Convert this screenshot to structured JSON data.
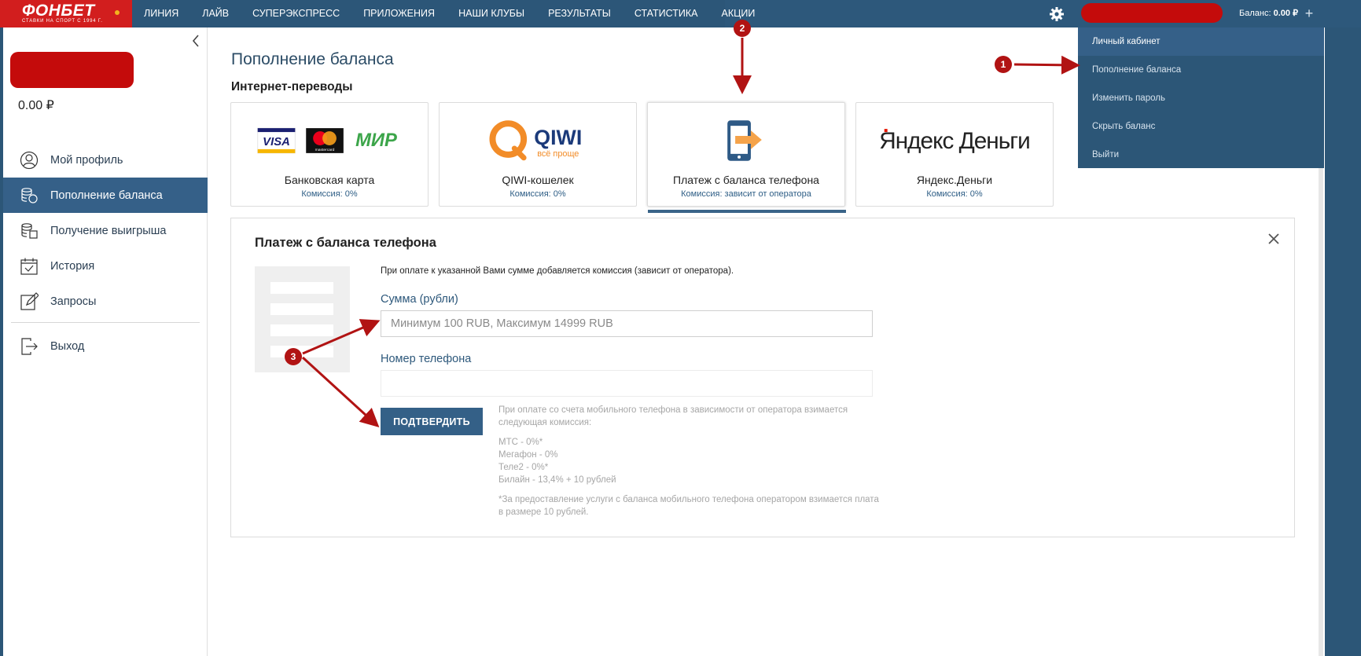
{
  "brand": {
    "name": "ФОНБЕТ",
    "tagline": "СТАВКИ НА СПОРТ С 1994 Г."
  },
  "nav": [
    "ЛИНИЯ",
    "ЛАЙВ",
    "СУПЕРЭКСПРЕСС",
    "ПРИЛОЖЕНИЯ",
    "НАШИ КЛУБЫ",
    "РЕЗУЛЬТАТЫ",
    "СТАТИСТИКА",
    "АКЦИИ"
  ],
  "header": {
    "balance_label": "Баланс:",
    "balance_value": "0.00 ₽",
    "icons": [
      "gear-icon",
      "plus-icon"
    ]
  },
  "dropdown": [
    "Личный кабинет",
    "Пополнение баланса",
    "Изменить пароль",
    "Скрыть баланс",
    "Выйти"
  ],
  "sidebar": {
    "balance": "0.00 ₽",
    "items": [
      {
        "label": "Мой профиль",
        "icon": "profile-icon",
        "active": false
      },
      {
        "label": "Пополнение баланса",
        "icon": "coins-deposit-icon",
        "active": true
      },
      {
        "label": "Получение выигрыша",
        "icon": "coins-withdraw-icon",
        "active": false
      },
      {
        "label": "История",
        "icon": "calendar-check-icon",
        "active": false
      },
      {
        "label": "Запросы",
        "icon": "edit-icon",
        "active": false
      }
    ],
    "logout": {
      "label": "Выход",
      "icon": "logout-icon"
    }
  },
  "main": {
    "title": "Пополнение баланса",
    "section": "Интернет-переводы",
    "methods": [
      {
        "name": "Банковская карта",
        "fee": "Комиссия: 0%",
        "logos": [
          "VISA",
          "mastercard",
          "МИР"
        ]
      },
      {
        "name": "QIWI-кошелек",
        "fee": "Комиссия: 0%",
        "logo": "QIWI",
        "slogan": "всё проще"
      },
      {
        "name": "Платеж с баланса телефона",
        "fee": "Комиссия: зависит от оператора",
        "icon": "phone-transfer-icon",
        "selected": true
      },
      {
        "name": "Яндекс.Деньги",
        "fee": "Комиссия: 0%",
        "logo": "Яндекс Деньги"
      }
    ]
  },
  "panel": {
    "title": "Платеж с баланса телефона",
    "note": "При оплате к указанной Вами сумме добавляется комиссия (зависит от оператора).",
    "amount_label": "Сумма (рубли)",
    "amount_placeholder": "Минимум 100 RUB, Максимум 14999 RUB",
    "phone_label": "Номер телефона",
    "confirm_label": "ПОДТВЕРДИТЬ",
    "fee_intro": "При оплате со счета мобильного телефона в зависимости от оператора взимается следующая комиссия:",
    "fees": [
      "МТС - 0%*",
      "Мегафон - 0%",
      "Теле2 - 0%*",
      "Билайн - 13,4% + 10 рублей"
    ],
    "footnote": "*За предоставление услуги с баланса мобильного телефона оператором взимается плата в размере 10 рублей."
  },
  "annotations": [
    "1",
    "2",
    "3"
  ],
  "colors": {
    "header": "#2d587b",
    "accent": "#356088",
    "brand_red": "#d21e1e",
    "annotation_red": "#b11313"
  }
}
